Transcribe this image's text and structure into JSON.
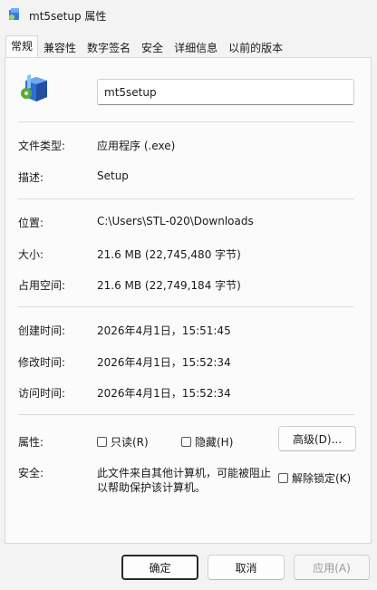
{
  "window": {
    "title": "mt5setup 属性"
  },
  "tabs": [
    {
      "label": "常规"
    },
    {
      "label": "兼容性"
    },
    {
      "label": "数字签名"
    },
    {
      "label": "安全"
    },
    {
      "label": "详细信息"
    },
    {
      "label": "以前的版本"
    }
  ],
  "general": {
    "file_name": "mt5setup",
    "file_type_label": "文件类型:",
    "file_type_value": "应用程序 (.exe)",
    "description_label": "描述:",
    "description_value": "Setup",
    "location_label": "位置:",
    "location_value": "C:\\Users\\STL-020\\Downloads",
    "size_label": "大小:",
    "size_value": "21.6 MB (22,745,480 字节)",
    "size_on_disk_label": "占用空间:",
    "size_on_disk_value": "21.6 MB (22,749,184 字节)",
    "created_label": "创建时间:",
    "created_value": "2026年4月1日，15:51:45",
    "modified_label": "修改时间:",
    "modified_value": "2026年4月1日，15:52:34",
    "accessed_label": "访问时间:",
    "accessed_value": "2026年4月1日，15:52:34",
    "attributes_label": "属性:",
    "readonly_label": "只读(R)",
    "hidden_label": "隐藏(H)",
    "advanced_label": "高级(D)...",
    "security_label": "安全:",
    "security_text_1": "此文件来自其他计算机，可能被阻止",
    "security_text_2": "以帮助保护该计算机。",
    "unblock_label": "解除锁定(K)"
  },
  "footer": {
    "ok_label": "确定",
    "cancel_label": "取消",
    "apply_label": "应用(A)"
  }
}
